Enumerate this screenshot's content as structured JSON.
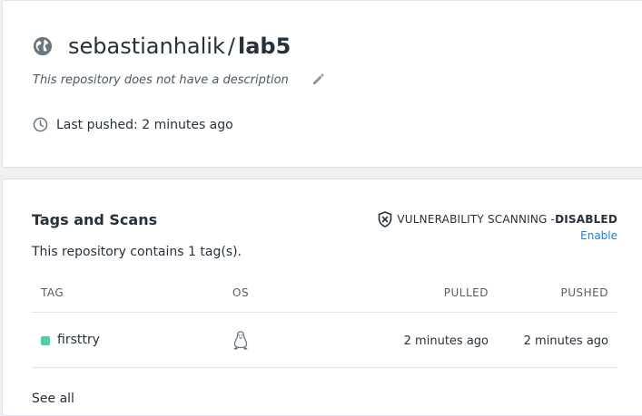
{
  "repository": {
    "owner": "sebastianhalik",
    "separator": "/",
    "name": "lab5",
    "description": "This repository does not have a description",
    "last_pushed": "Last pushed: 2 minutes ago",
    "icons": {
      "visibility": "globe-icon",
      "edit": "pencil-icon",
      "time": "clock-icon"
    }
  },
  "tags_section": {
    "title": "Tags and Scans",
    "scan_label": "VULNERABILITY SCANNING - ",
    "scan_state": "DISABLED",
    "enable_link": "Enable",
    "tag_count_text": "This repository contains 1 tag(s).",
    "columns": {
      "tag": "TAG",
      "os": "OS",
      "pulled": "PULLED",
      "pushed": "PUSHED"
    },
    "rows": [
      {
        "tag": "firsttry",
        "os": "linux",
        "pulled": "2 minutes ago",
        "pushed": "2 minutes ago",
        "status_color": "#4fd1a5"
      }
    ],
    "see_all": "See all"
  },
  "colors": {
    "link": "#1c7ed6",
    "text": "#27313a",
    "muted": "#555f68",
    "status_dot": "#4fd1a5"
  }
}
